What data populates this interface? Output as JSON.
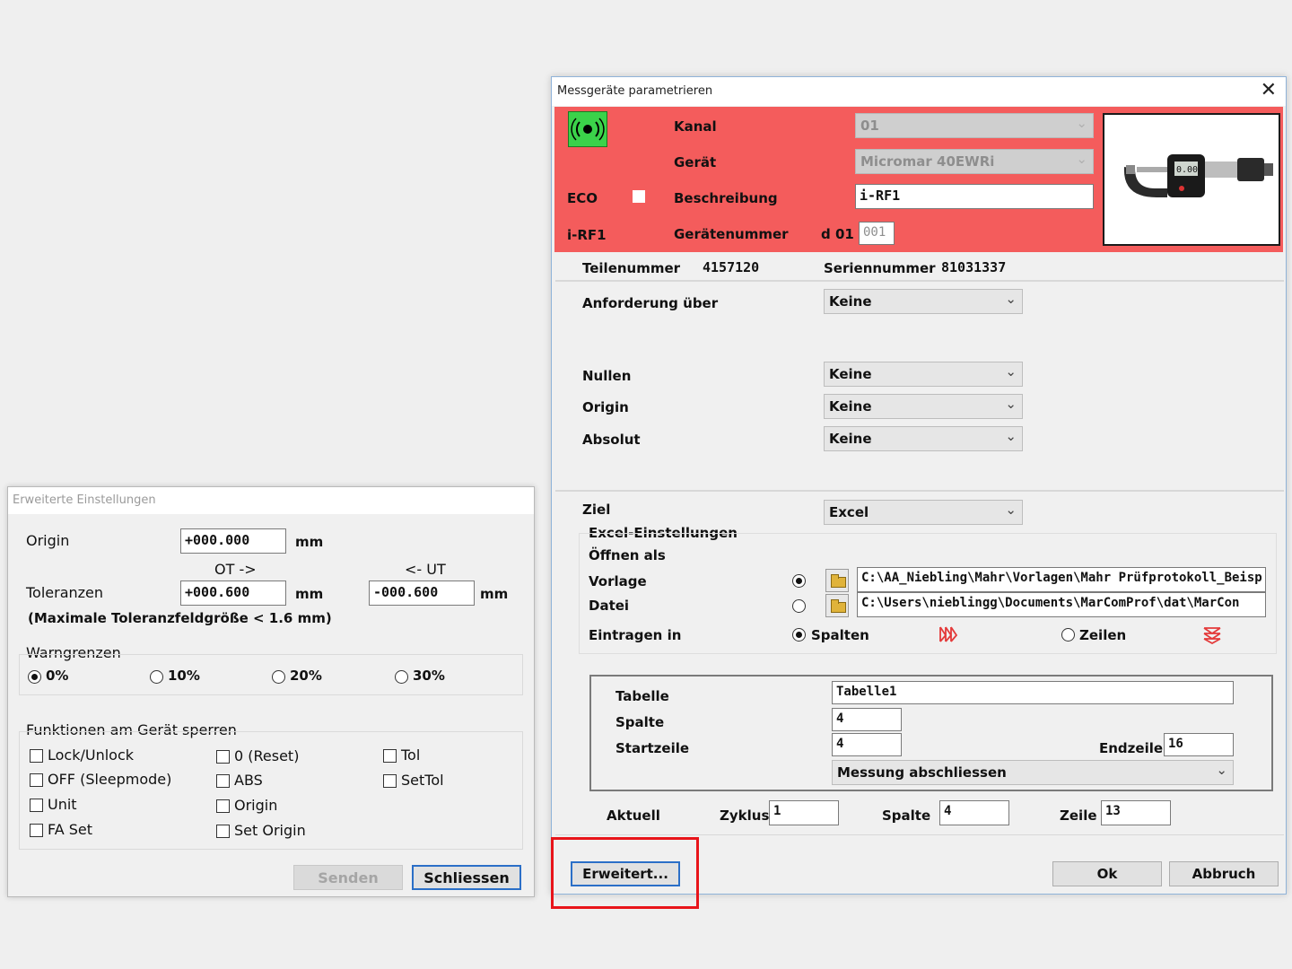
{
  "small_dialog": {
    "title": "Erweiterte Einstellungen",
    "origin_label": "Origin",
    "origin_value": "+000.000",
    "unit": "mm",
    "ot_label": "OT ->",
    "ut_label": "<- UT",
    "tol_label": "Toleranzen",
    "tol_ot_value": "+000.600",
    "tol_ut_value": "-000.600",
    "tol_note": "(Maximale Toleranzfeldgröße < 1.6 mm)",
    "warn_label": "Warngrenzen",
    "warn_options": [
      "0%",
      "10%",
      "20%",
      "30%"
    ],
    "warn_selected": "0%",
    "lock_label": "Funktionen am Gerät sperren",
    "lock_col1": [
      "Lock/Unlock",
      "OFF (Sleepmode)",
      "Unit",
      "FA Set"
    ],
    "lock_col2": [
      "0 (Reset)",
      "ABS",
      "Origin",
      "Set Origin"
    ],
    "lock_col3": [
      "Tol",
      "SetTol"
    ],
    "send_button": "Senden",
    "close_button": "Schliessen"
  },
  "main_dialog": {
    "title": "Messgeräte parametrieren",
    "kanal_label": "Kanal",
    "kanal_value": "01",
    "geraet_label": "Gerät",
    "geraet_value": "Micromar 40EWRi",
    "eco_label": "ECO",
    "beschreibung_label": "Beschreibung",
    "beschreibung_value": "i-RF1",
    "device_tag": "i-RF1",
    "geraetenummer_label": "Gerätenummer",
    "geraetenummer_prefix": "d 01",
    "geraetenummer_value": "001",
    "teilenummer_label": "Teilenummer",
    "teilenummer_value": "4157120",
    "seriennummer_label": "Seriennummer",
    "seriennummer_value": "81031337",
    "anforderung_label": "Anforderung über",
    "anforderung_value": "Keine",
    "nullen_label": "Nullen",
    "nullen_value": "Keine",
    "origin_label": "Origin",
    "origin_value": "Keine",
    "absolut_label": "Absolut",
    "absolut_value": "Keine",
    "ziel_label": "Ziel",
    "ziel_value": "Excel",
    "excel_heading": "Excel-Einstellungen",
    "oeffnen_label": "Öffnen als",
    "vorlage_label": "Vorlage",
    "vorlage_path": "C:\\AA_Niebling\\Mahr\\Vorlagen\\Mahr Prüfprotokoll_Beisp",
    "datei_label": "Datei",
    "datei_path": "C:\\Users\\nieblingg\\Documents\\MarComProf\\dat\\MarCon",
    "eintragen_label": "Eintragen in",
    "spalten_option": "Spalten",
    "zeilen_option": "Zeilen",
    "tabelle_label": "Tabelle",
    "tabelle_value": "Tabelle1",
    "spalte_label": "Spalte",
    "spalte_value": "4",
    "startzeile_label": "Startzeile",
    "startzeile_value": "4",
    "endzeile_label": "Endzeile",
    "endzeile_value": "16",
    "messung_value": "Messung abschliessen",
    "aktuell_label": "Aktuell",
    "zyklus_label": "Zyklus",
    "zyklus_value": "1",
    "aktuell_spalte_label": "Spalte",
    "aktuell_spalte_value": "4",
    "zeile_label": "Zeile",
    "zeile_value": "13",
    "erweitert_button": "Erweitert...",
    "ok_button": "Ok",
    "abbruch_button": "Abbruch"
  },
  "colors": {
    "red_panel": "#f45c5c",
    "highlight": "#e8141a",
    "focus_border": "#2b6fc7"
  },
  "icons": [
    "wireless-signal-icon",
    "micrometer-image",
    "folder-icon",
    "columns-icon",
    "rows-icon",
    "close-icon",
    "chevron-down-icon"
  ]
}
